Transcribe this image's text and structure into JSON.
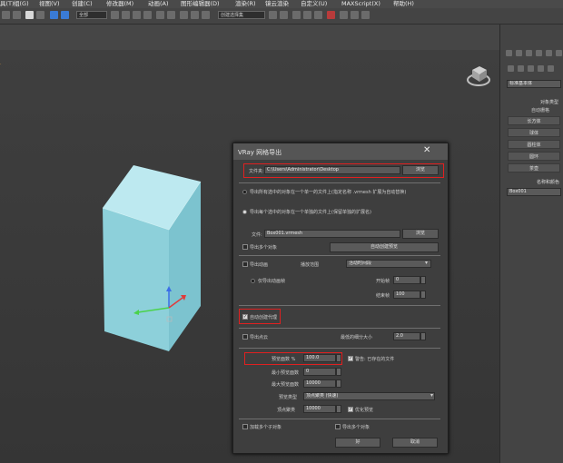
{
  "menubar": {
    "items": [
      "具(T)",
      "组(G)",
      "视图(V)",
      "创建(C)",
      "修改器(M)",
      "动画(A)",
      "图形编辑器(D)",
      "渲染(R)",
      "镜云渲染",
      "自定义(U)",
      "MAXScript(X)",
      "帮助(H)"
    ]
  },
  "toolbar": {
    "filter_dropdown": "全部",
    "selection_set_dropdown": "创建选择集"
  },
  "command_panel": {
    "name_field": "标准基本体",
    "section_title": "对象类型",
    "auto_grid": "自动栅格",
    "buttons": [
      "长方体",
      "球体",
      "圆柱体",
      "圆环",
      "茶壶"
    ],
    "name_color_title": "名称和颜色",
    "object_name": "Box001"
  },
  "dialog": {
    "title": "VRay 网格导出",
    "folder_label": "文件夹:",
    "folder_path": "C:\\Users\\Administrator\\Desktop",
    "browse1": "浏览",
    "radio_each_object": "导出所有选中的对象在一个单一的文件上(指定名称 .vrmesh 扩展为自动替换)",
    "radio_single_file": "导出每个选中的对象在一个单独的文件上(保留单独的扩展名)",
    "file_label": "文件:",
    "file_name": "Box001.vrmesh",
    "browse2": "浏览",
    "export_multiple": "导出多个对象",
    "create_preview": "自动创建预览",
    "export_anim": "导出动画",
    "playback_label": "播放范围",
    "playback_value": "活动时间段",
    "use_motion_blur": "仅导出动画帧",
    "start_frame_label": "开始帧",
    "start_frame_value": "0",
    "end_frame_label": "结束帧",
    "end_frame_value": "100",
    "auto_proxy": "自动创建代理",
    "export_point": "导出点云",
    "point_size_label": "最低的细分大小",
    "point_size_value": "2.0",
    "preview_faces_label": "预览面数 %",
    "preview_faces_value": "100.0",
    "overwrite": "警告: 已存在的文件",
    "min_preview_label": "最小预览面数",
    "min_preview_value": "0",
    "max_preview_label": "最大预览面数",
    "max_preview_value": "10000",
    "preview_type_label": "预览类型",
    "preview_type_value": "顶点聚类 (快速)",
    "vertex_cluster_label": "顶点聚类",
    "vertex_cluster_value": "10000",
    "optimize": "优化预览",
    "merge_label": "加载多个子对象",
    "keep_label": "导出多个对象",
    "ok": "好",
    "cancel": "取消"
  }
}
